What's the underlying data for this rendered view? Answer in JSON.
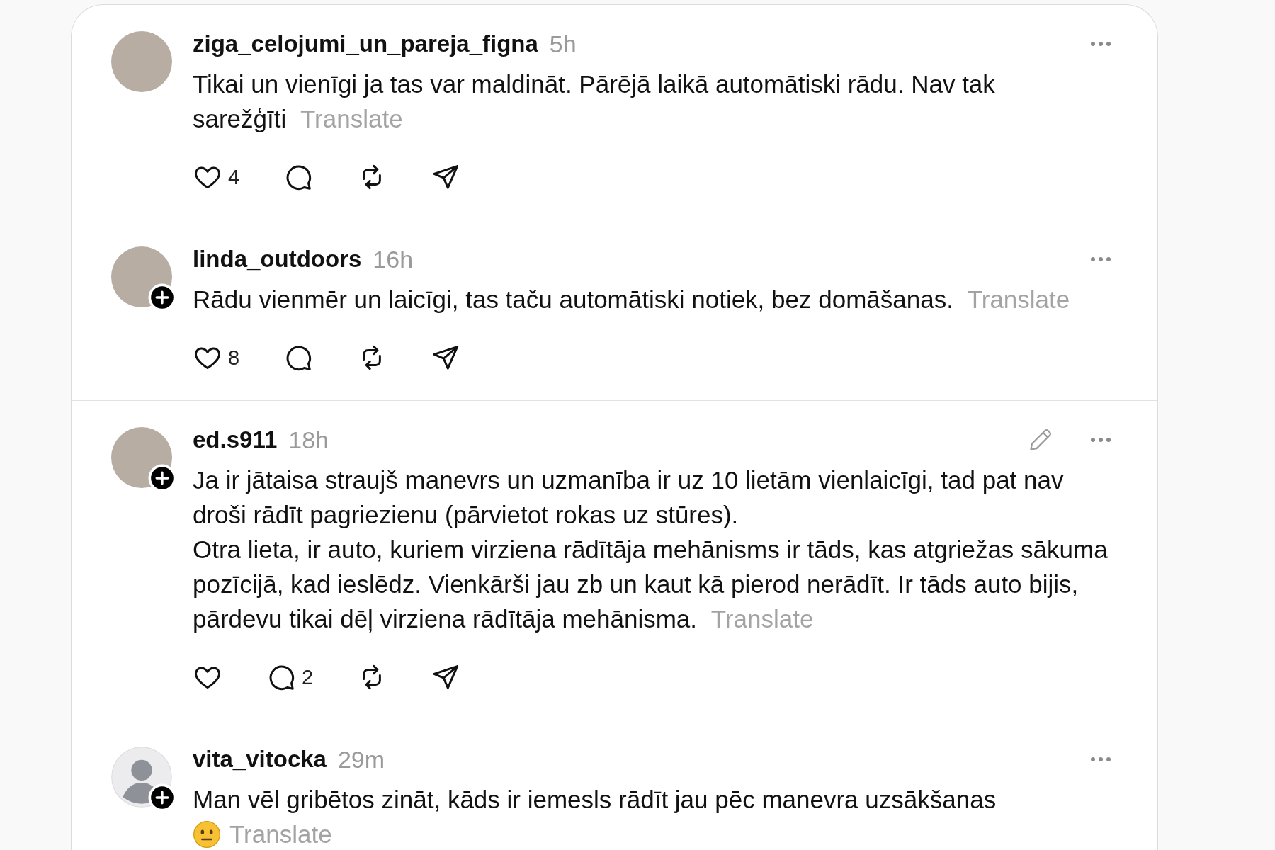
{
  "feed": {
    "posts": [
      {
        "username": "ziga_celojumi_un_pareja_figna",
        "time": "5h",
        "avatar": {
          "kind": "photo",
          "follow_badge": false
        },
        "editable": false,
        "text": "Tikai un vienīgi ja tas var maldināt. Pārējā laikā automātiski rādu. Nav tak\nsarežģīti",
        "emoji": false,
        "translate": "Translate",
        "actions": [
          {
            "kind": "like",
            "count": "4"
          },
          {
            "kind": "comment"
          },
          {
            "kind": "repost"
          },
          {
            "kind": "share"
          }
        ]
      },
      {
        "username": "linda_outdoors",
        "time": "16h",
        "avatar": {
          "kind": "photo",
          "follow_badge": true
        },
        "editable": false,
        "text": "Rādu vienmēr un laicīgi, tas taču automātiski notiek, bez domāšanas.",
        "emoji": false,
        "translate": "Translate",
        "actions": [
          {
            "kind": "like",
            "count": "8"
          },
          {
            "kind": "comment"
          },
          {
            "kind": "repost"
          },
          {
            "kind": "share"
          }
        ]
      },
      {
        "username": "ed.s911",
        "time": "18h",
        "avatar": {
          "kind": "photo",
          "follow_badge": true
        },
        "editable": true,
        "text": "Ja ir jātaisa straujš manevrs un uzmanība ir uz 10 lietām vienlaicīgi, tad pat nav droši rādīt pagriezienu (pārvietot rokas uz stūres).\nOtra lieta, ir auto, kuriem virziena rādītāja mehānisms ir tāds, kas atgriežas sākuma pozīcijā, kad ieslēdz. Vienkārši jau zb un kaut kā pierod nerādīt. Ir tāds auto bijis, pārdevu tikai dēļ virziena rādītāja mehānisma.",
        "emoji": false,
        "translate": "Translate",
        "actions": [
          {
            "kind": "like"
          },
          {
            "kind": "comment",
            "count": "2"
          },
          {
            "kind": "repost"
          },
          {
            "kind": "share"
          }
        ]
      },
      {
        "username": "vita_vitocka",
        "time": "29m",
        "avatar": {
          "kind": "default",
          "follow_badge": true
        },
        "editable": false,
        "text": "Man vēl gribētos zināt, kāds ir iemesls rādīt jau pēc manevra uzsākšanas",
        "emoji": true,
        "translate": "Translate"
      }
    ]
  }
}
